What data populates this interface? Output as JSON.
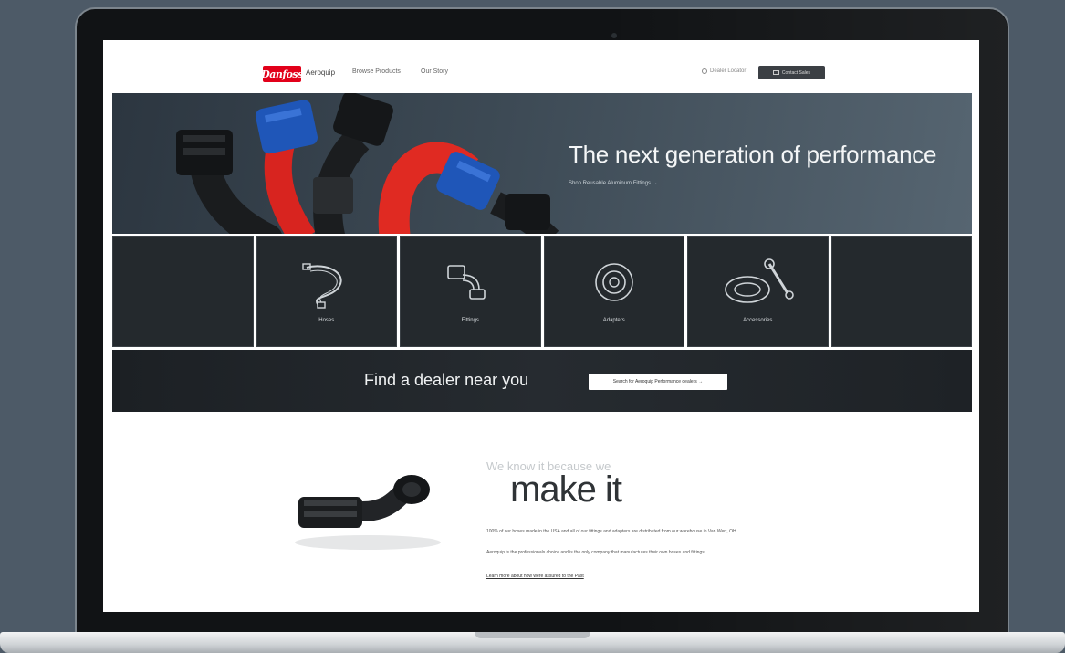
{
  "nav": {
    "brand_mark": "Danfoss",
    "product_name": "Aeroquip",
    "links": [
      "Browse Products",
      "Our Story"
    ],
    "search_label": "Dealer Locator",
    "cta_label": "Contact Sales"
  },
  "hero": {
    "title": "The next generation of performance",
    "link": "Shop Reusable Aluminum Fittings →"
  },
  "categories": [
    "Hoses",
    "Fittings",
    "Adapters",
    "Accessories"
  ],
  "dealer": {
    "title": "Find a dealer near you",
    "button": "Search for Aeroquip Performance dealers →"
  },
  "make_it": {
    "kicker": "We know it because we",
    "headline": "make it",
    "para1": "100% of our hoses made in the USA and all of our fittings and adapters are distributed from our warehouse in Van Wert, OH.",
    "para2": "Aeroquip is the professionals choice and is the only company that manufactures their own hoses and fittings.",
    "link": "Learn more about how were assured to the Past"
  },
  "colors": {
    "brand_red": "#e2001a",
    "hero_bg": "#3d4a55",
    "tile_bg": "#24292d",
    "laptop_bg": "#4d5a67"
  }
}
